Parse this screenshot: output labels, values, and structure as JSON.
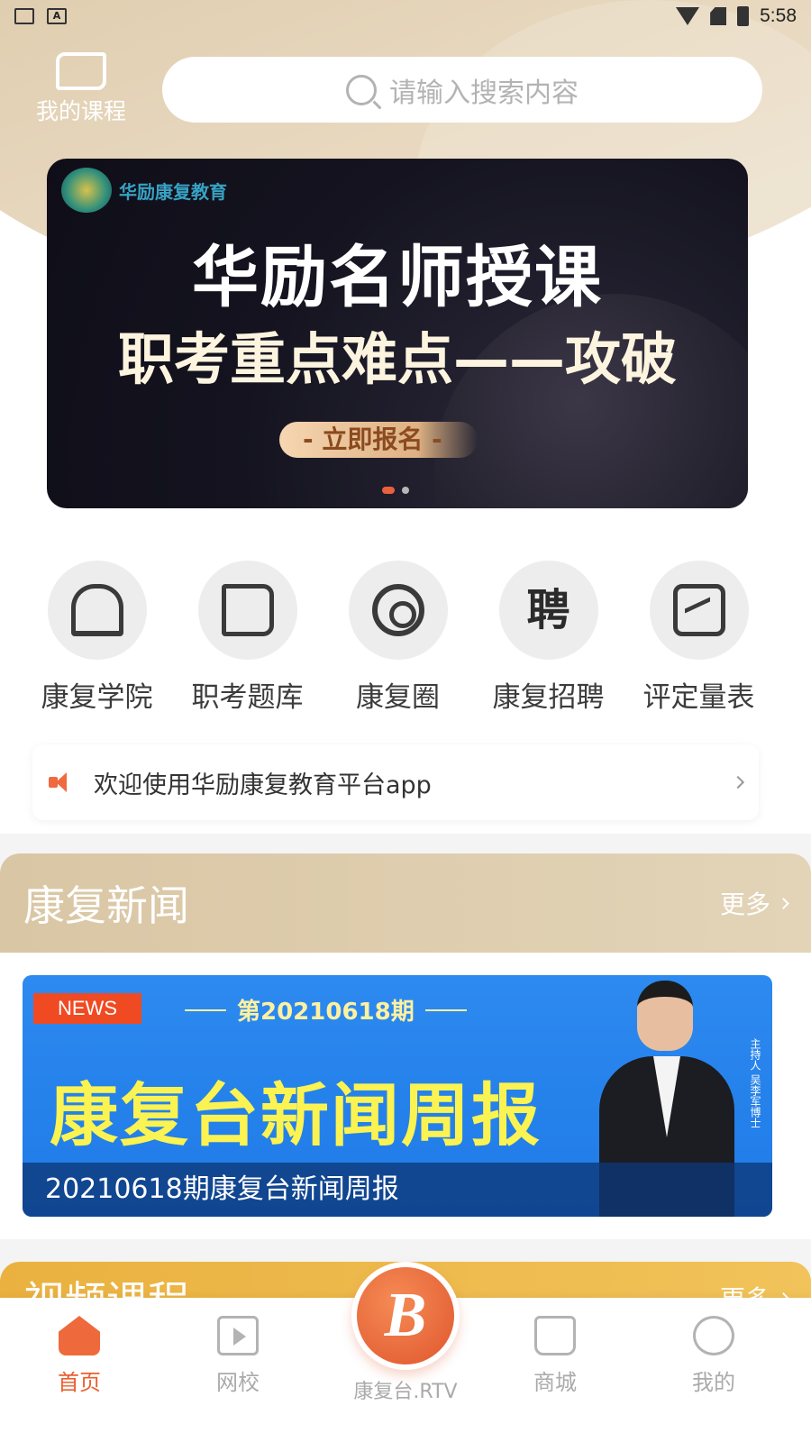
{
  "status_bar": {
    "time": "5:58",
    "left_icons": [
      "image-icon",
      "a-icon"
    ],
    "right_icons": [
      "wifi-icon",
      "sim-icon",
      "battery-icon"
    ]
  },
  "header": {
    "my_courses_label": "我的课程",
    "search_placeholder": "请输入搜索内容"
  },
  "banner": {
    "brand": "华励康复教育",
    "headline_1": "华励名师授课",
    "headline_2": "职考重点难点——攻破",
    "cta": "- 立即报名 -",
    "slide_count": 2,
    "active_slide": 0
  },
  "quick_nav": [
    {
      "label": "康复学院",
      "icon": "building-icon"
    },
    {
      "label": "职考题库",
      "icon": "book-icon"
    },
    {
      "label": "康复圈",
      "icon": "circle-icon"
    },
    {
      "label": "康复招聘",
      "icon": "recruit-icon",
      "glyph": "聘"
    },
    {
      "label": "评定量表",
      "icon": "chart-icon"
    }
  ],
  "notice": {
    "text": "欢迎使用华励康复教育平台app"
  },
  "news": {
    "title": "康复新闻",
    "more": "更多",
    "card": {
      "tag": "NEWS",
      "issue": "第20210618期",
      "big_title": "康复台新闻周报",
      "host_caption": "主持人 吴李军博士",
      "caption": "20210618期康复台新闻周报"
    }
  },
  "video": {
    "title": "视频课程",
    "more": "更多"
  },
  "bottom_nav": {
    "home": "首页",
    "school": "网校",
    "center": "康复台.RTV",
    "center_logo": "B",
    "mall": "商城",
    "mine": "我的"
  },
  "colors": {
    "accent": "#ea5f2f",
    "tan": "#d9c6a4",
    "gold": "#eab13f",
    "news_blue": "#2d8af0"
  }
}
